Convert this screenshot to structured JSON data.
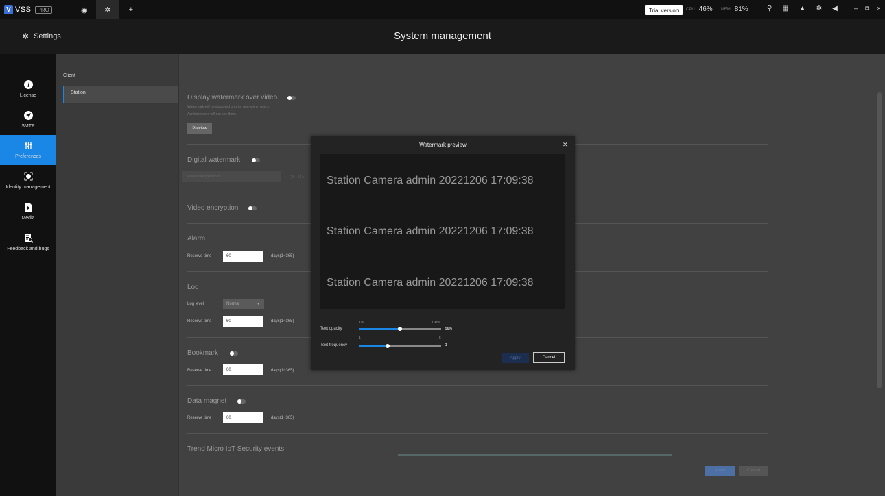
{
  "topbar": {
    "logo_text": "VSS",
    "logo_badge": "PRO",
    "trial": "Trial version",
    "cpu_label": "CPU",
    "cpu_value": "46%",
    "mem_label": "MEM",
    "mem_value": "81%"
  },
  "header": {
    "settings": "Settings",
    "title": "System management"
  },
  "leftnav": {
    "items": [
      {
        "label": "License",
        "icon": "info-icon"
      },
      {
        "label": "SMTP",
        "icon": "smtp-icon"
      },
      {
        "label": "Preferences",
        "icon": "sliders-icon"
      },
      {
        "label": "Identity management",
        "icon": "identity-icon"
      },
      {
        "label": "Media",
        "icon": "media-icon"
      },
      {
        "label": "Feedback and bugs",
        "icon": "feedback-icon"
      }
    ]
  },
  "subnav": {
    "client": "Client",
    "station": "Station"
  },
  "content": {
    "display_watermark": "Display watermark over video",
    "hint1": "Watermark will be displayed only for non-admin users.",
    "hint2": "Administrators will not see them.",
    "preview_btn": "Preview",
    "digital_watermark": "Digital watermark",
    "wm_password_placeholder": "Watermark password",
    "wm_password_hint": "(16 - 64 c",
    "video_encryption": "Video encryption",
    "alarm": "Alarm",
    "reserve_time": "Reserve time",
    "reserve_value": "60",
    "days": "days(1~365)",
    "log": "Log",
    "log_level": "Log level",
    "log_level_value": "Normal",
    "bookmark": "Bookmark",
    "data_magnet": "Data magnet",
    "trend_micro": "Trend Micro IoT Security events",
    "apply": "Apply",
    "cancel": "Cancel"
  },
  "modal": {
    "title": "Watermark preview",
    "watermark_text": "Station Camera admin 20221206 17:09:38",
    "opacity_label": "Text opacity",
    "opacity_min": "1%",
    "opacity_max": "100%",
    "opacity_value": "50%",
    "opacity_fraction": 0.5,
    "frequency_label": "Text frequency",
    "frequency_min": "1",
    "frequency_max": "5",
    "frequency_value": "3",
    "frequency_fraction": 0.35,
    "apply": "Apply",
    "cancel": "Cancel"
  }
}
